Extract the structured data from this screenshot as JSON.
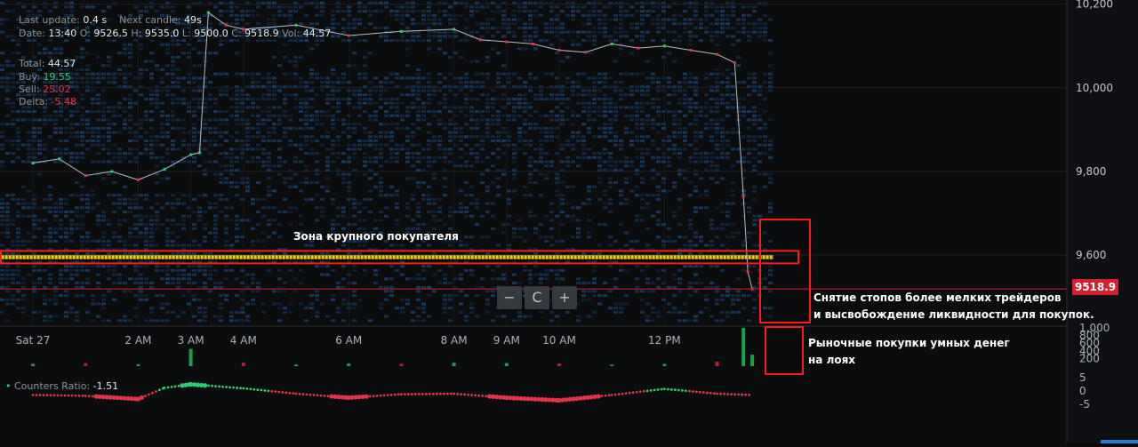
{
  "hud": {
    "last_update_label": "Last update:",
    "last_update": "0.4 s",
    "next_candle_label": "Next candle:",
    "next_candle": "49s",
    "date_label": "Date:",
    "date": "13:40",
    "o_label": "O:",
    "open": "9526.5",
    "h_label": "H:",
    "high": "9535.0",
    "l_label": "L:",
    "low": "9500.0",
    "c_label": "C:",
    "close": "9518.9",
    "v_label": "Vol:",
    "vol": "44.57",
    "total_label": "Total:",
    "total": "44.57",
    "buy_label": "Buy:",
    "buy": "19.55",
    "sell_label": "Sell:",
    "sell": "25.02",
    "delta_label": "Delta:",
    "delta": "-5.48"
  },
  "price_axis": {
    "ticks": [
      "10,200",
      "10,000",
      "9,800",
      "9,600"
    ],
    "current_price": "9518.9"
  },
  "volume_axis": {
    "ticks": [
      "1,000",
      "800",
      "600",
      "400",
      "200"
    ]
  },
  "ratio_axis": {
    "ticks": [
      "5",
      "0",
      "-5"
    ]
  },
  "time_axis": {
    "ticks": [
      "Sat 27",
      "2 AM",
      "3 AM",
      "4 AM",
      "6 AM",
      "8 AM",
      "9 AM",
      "10 AM",
      "12 PM"
    ]
  },
  "counters_ratio": {
    "label": "Counters Ratio:",
    "value": "-1.51"
  },
  "zoom": {
    "minus": "−",
    "reset": "C",
    "plus": "+"
  },
  "annotations": {
    "buyer_zone": "Зона крупного покупателя",
    "stops_line1": "Снятие стопов более мелких трейдеров",
    "stops_line2": "и высвобождение ликвидности для покупок.",
    "smart_line1": "Рыночные покупки умных денег",
    "smart_line2": "на лоях"
  },
  "colors": {
    "background": "#0b0c0e",
    "buy": "#2ecc71",
    "sell": "#e0344b",
    "heatmap": "#1c3550",
    "big_buyer": "#e9d21c",
    "annotation_box": "#ff1a1a"
  },
  "chart_data": [
    {
      "type": "line",
      "title": "",
      "xlabel": "",
      "ylabel": "",
      "x": [
        "00:00",
        "00:30",
        "01:00",
        "01:30",
        "02:00",
        "02:30",
        "03:00",
        "03:10",
        "03:20",
        "03:40",
        "04:00",
        "05:00",
        "06:00",
        "07:00",
        "08:00",
        "08:30",
        "09:00",
        "09:30",
        "10:00",
        "10:30",
        "11:00",
        "11:30",
        "12:00",
        "12:30",
        "13:00",
        "13:20",
        "13:30",
        "13:35",
        "13:40"
      ],
      "series": [
        {
          "values": [
            9820,
            9830,
            9790,
            9800,
            9780,
            9805,
            9840,
            9845,
            10180,
            10150,
            10140,
            10150,
            10125,
            10135,
            10140,
            10115,
            10110,
            10105,
            10090,
            10085,
            10105,
            10095,
            10100,
            10090,
            10080,
            10060,
            9740,
            9560,
            9518.9
          ]
        }
      ],
      "ylim": [
        9430,
        10210
      ],
      "grid": true,
      "big_buyer_level": 9595
    },
    {
      "type": "bar",
      "title": "",
      "x": [
        "00:00",
        "01:00",
        "02:00",
        "03:00",
        "04:00",
        "05:00",
        "06:00",
        "07:00",
        "08:00",
        "09:00",
        "10:00",
        "11:00",
        "12:00",
        "13:00",
        "13:30",
        "13:40"
      ],
      "series": [
        {
          "name": "",
          "values": [
            60,
            80,
            50,
            450,
            90,
            40,
            70,
            60,
            90,
            80,
            70,
            40,
            60,
            120,
            1000,
            300
          ]
        }
      ],
      "ylim": [
        0,
        1000
      ]
    },
    {
      "type": "scatter",
      "title": "",
      "label": "Counters Ratio",
      "x": [
        "00:00",
        "01:00",
        "02:00",
        "02:30",
        "03:00",
        "04:00",
        "05:00",
        "06:00",
        "07:00",
        "08:00",
        "09:00",
        "10:00",
        "11:00",
        "12:00",
        "13:00",
        "13:40"
      ],
      "series": [
        {
          "values": [
            -1.5,
            -1.8,
            -3,
            1.2,
            2.5,
            1.0,
            -1,
            -2.5,
            -1.2,
            -1,
            -2.5,
            -3.5,
            -1.5,
            0.8,
            -1,
            -1.51
          ]
        }
      ],
      "ylim": [
        -6,
        6
      ]
    }
  ]
}
